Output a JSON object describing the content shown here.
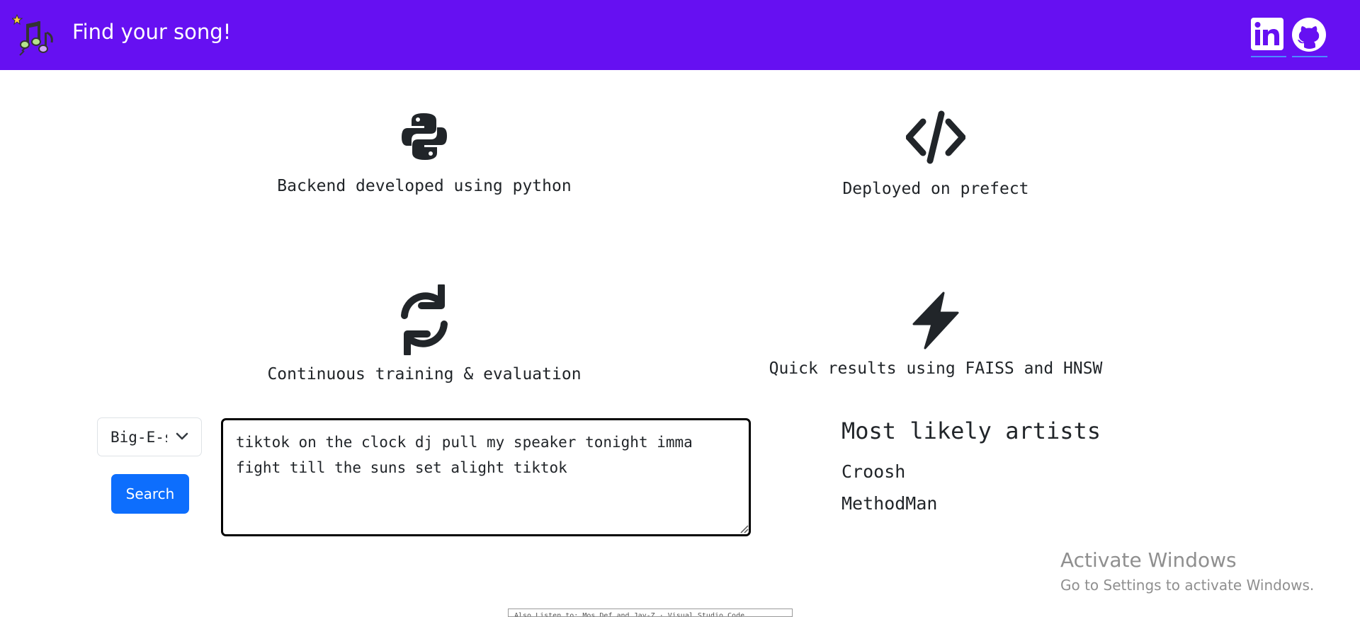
{
  "navbar": {
    "title": "Find your song!",
    "logo_icon": "music-notes-icon",
    "background_color": "#6610f2",
    "links": [
      {
        "name": "linkedin",
        "icon": "linkedin-icon"
      },
      {
        "name": "github",
        "icon": "github-icon"
      }
    ]
  },
  "features": [
    {
      "icon": "python-icon",
      "text": "Backend developed using python"
    },
    {
      "icon": "code-icon",
      "text": "Deployed on prefect"
    },
    {
      "icon": "sync-icon",
      "text": "Continuous training & evaluation"
    },
    {
      "icon": "bolt-icon",
      "text": "Quick results using FAISS and HNSW"
    }
  ],
  "search": {
    "selected_artist": "Big-E-s",
    "lyrics": "tiktok on the clock dj pull my speaker tonight imma fight till the suns set alight tiktok",
    "button_label": "Search",
    "button_color": "#0d6efd"
  },
  "results": {
    "title": "Most likely artists",
    "artists": [
      "Croosh",
      "MethodMan"
    ]
  },
  "watermark": {
    "title": "Activate Windows",
    "subtitle": "Go to Settings to activate Windows."
  },
  "footer": {
    "text": "Also Listen to: Mos Def and Jay-Z · Visual Studio Code"
  }
}
